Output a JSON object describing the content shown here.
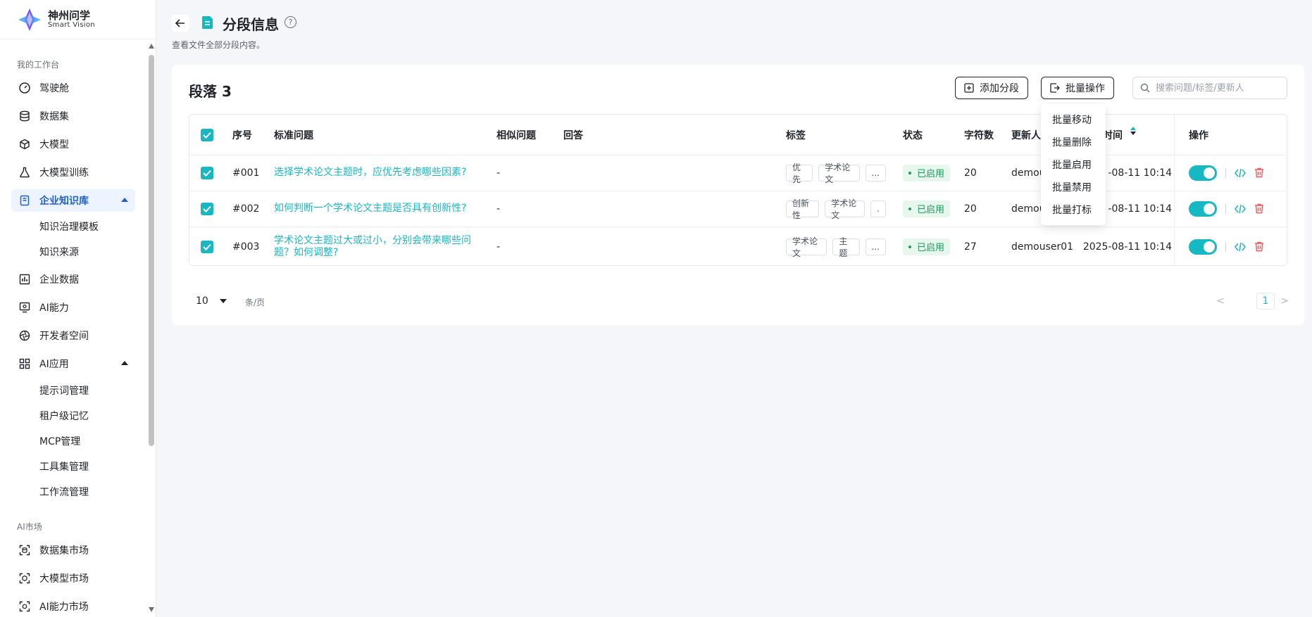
{
  "brand": {
    "name_cn": "神州问学",
    "name_en": "Smart Vision"
  },
  "sidebar": {
    "section_workspace": "我的工作台",
    "section_market": "AI市场",
    "items": [
      {
        "label": "驾驶舱",
        "icon": "gauge-icon"
      },
      {
        "label": "数据集",
        "icon": "database-icon"
      },
      {
        "label": "大模型",
        "icon": "cube-icon"
      },
      {
        "label": "大模型训练",
        "icon": "flask-icon"
      },
      {
        "label": "企业知识库",
        "icon": "book-icon",
        "active": true
      },
      {
        "label": "企业数据",
        "icon": "bar-chart-icon"
      },
      {
        "label": "AI能力",
        "icon": "monitor-icon"
      },
      {
        "label": "开发者空间",
        "icon": "aperture-icon"
      },
      {
        "label": "AI应用",
        "icon": "grid-icon"
      }
    ],
    "kb_children": [
      "知识治理模板",
      "知识来源"
    ],
    "app_children": [
      "提示词管理",
      "租户级记忆",
      "MCP管理",
      "工具集管理",
      "工作流管理"
    ],
    "market_items": [
      "数据集市场",
      "大模型市场",
      "AI能力市场"
    ]
  },
  "header": {
    "title": "分段信息",
    "description": "查看文件全部分段内容。"
  },
  "card": {
    "title": "段落 3",
    "add_button": "添加分段",
    "batch_button": "批量操作",
    "search_placeholder": "搜索问题/标签/更新人"
  },
  "table": {
    "columns": {
      "index": "序号",
      "question": "标准问题",
      "similar": "相似问题",
      "answer": "回答",
      "tags": "标签",
      "status": "状态",
      "chars": "字符数",
      "updater": "更新人",
      "time": "时间",
      "actions": "操作"
    },
    "rows": [
      {
        "index": "#001",
        "question_1": "选择学术论文主题时，应优先考虑哪些因素?",
        "question_2": "",
        "similar": "-",
        "tags": [
          "优先",
          "学术论文",
          "..."
        ],
        "status": "已启用",
        "chars": "20",
        "updater": "demou",
        "time": "-08-11 10:14"
      },
      {
        "index": "#002",
        "question_1": "如何判断一个学术论文主题是否具有创新性?",
        "question_2": "",
        "similar": "-",
        "tags": [
          "创新性",
          "学术论文",
          "."
        ],
        "status": "已启用",
        "chars": "20",
        "updater": "demou",
        "time": "-08-11 10:14"
      },
      {
        "index": "#003",
        "question_1": "学术论文主题过大或过小，分别会带来哪些问",
        "question_2": "题？如何调整?",
        "similar": "-",
        "tags": [
          "学术论文",
          "主题",
          "..."
        ],
        "status": "已启用",
        "chars": "27",
        "updater": "demouser01",
        "time": "2025-08-11 10:14"
      }
    ]
  },
  "batch_menu": [
    "批量移动",
    "批量删除",
    "批量启用",
    "批量禁用",
    "批量打标"
  ],
  "pager": {
    "size": "10",
    "unit": "条/页",
    "current": "1",
    "prev": "<",
    "next": ">"
  },
  "colors": {
    "accent": "#16b8c4",
    "active_nav": "#1d5fd6",
    "status_green": "#1a9d5a",
    "delete_red": "#f5575b"
  }
}
